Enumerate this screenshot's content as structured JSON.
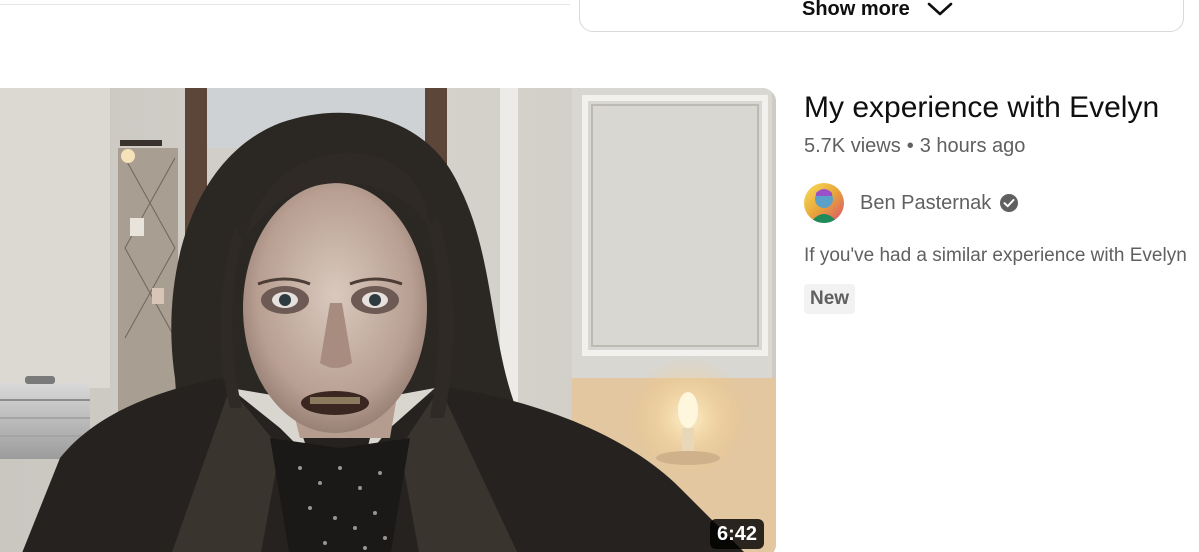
{
  "show_more": {
    "label": "Show more",
    "icon": "chevron-down-icon"
  },
  "video": {
    "title": "My experience with Evelyn",
    "views": "5.7K views",
    "separator": "•",
    "age": "3 hours ago",
    "duration": "6:42",
    "channel": {
      "name": "Ben Pasternak",
      "verified_icon": "verified-check-icon"
    },
    "description": "If you've had a similar experience with Evelyn",
    "badge": "New"
  },
  "colors": {
    "text_primary": "#0f0f0f",
    "text_secondary": "#606060",
    "badge_bg": "#f2f2f2",
    "duration_bg": "#000000cc",
    "border": "#d9d9d9"
  }
}
